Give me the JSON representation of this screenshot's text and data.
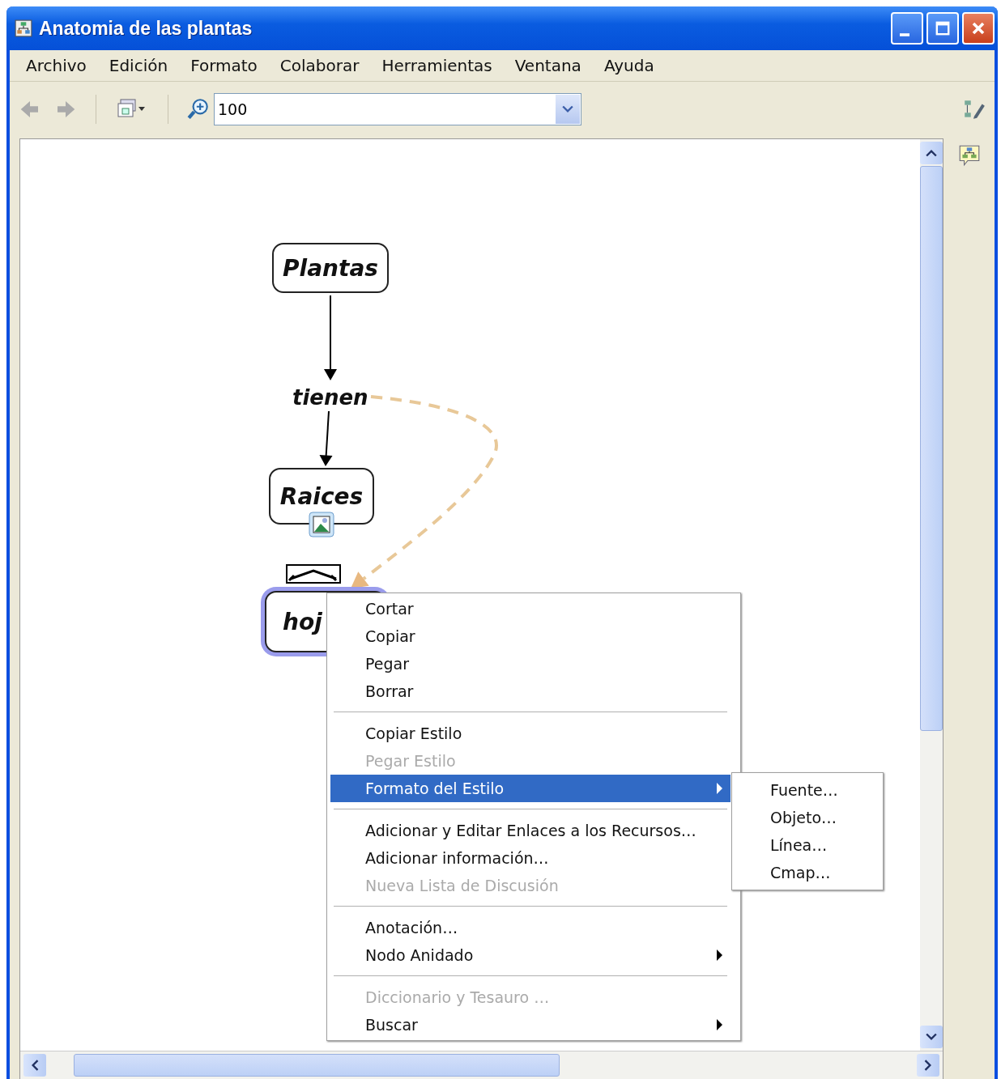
{
  "window": {
    "title": "Anatomia de las plantas"
  },
  "menu_bar": [
    "Archivo",
    "Edición",
    "Formato",
    "Colaborar",
    "Herramientas",
    "Ventana",
    "Ayuda"
  ],
  "toolbar": {
    "zoom_field": {
      "value": "100"
    }
  },
  "concept_map": {
    "concepts": [
      {
        "label": "Plantas",
        "selected": false,
        "has_image": false
      },
      {
        "label": "Raices",
        "selected": false,
        "has_image": true
      },
      {
        "label": "hoj",
        "selected": true,
        "has_image": false
      }
    ],
    "linking_phrases": [
      {
        "label": "tienen"
      }
    ]
  },
  "context_menu": {
    "items": [
      {
        "kind": "item",
        "label": "Cortar",
        "disabled": false,
        "selected": false,
        "has_submenu": false
      },
      {
        "kind": "item",
        "label": "Copiar",
        "disabled": false,
        "selected": false,
        "has_submenu": false
      },
      {
        "kind": "item",
        "label": "Pegar",
        "disabled": false,
        "selected": false,
        "has_submenu": false
      },
      {
        "kind": "item",
        "label": "Borrar",
        "disabled": false,
        "selected": false,
        "has_submenu": false
      },
      {
        "kind": "separator"
      },
      {
        "kind": "item",
        "label": "Copiar Estilo",
        "disabled": false,
        "selected": false,
        "has_submenu": false
      },
      {
        "kind": "item",
        "label": "Pegar Estilo",
        "disabled": true,
        "selected": false,
        "has_submenu": false
      },
      {
        "kind": "item",
        "label": "Formato del Estilo",
        "disabled": false,
        "selected": true,
        "has_submenu": true
      },
      {
        "kind": "separator"
      },
      {
        "kind": "item",
        "label": "Adicionar y Editar Enlaces a los Recursos…",
        "disabled": false,
        "selected": false,
        "has_submenu": false
      },
      {
        "kind": "item",
        "label": "Adicionar información…",
        "disabled": false,
        "selected": false,
        "has_submenu": false
      },
      {
        "kind": "item",
        "label": "Nueva Lista de Discusión",
        "disabled": true,
        "selected": false,
        "has_submenu": false
      },
      {
        "kind": "separator"
      },
      {
        "kind": "item",
        "label": "Anotación…",
        "disabled": false,
        "selected": false,
        "has_submenu": false
      },
      {
        "kind": "item",
        "label": "Nodo Anidado",
        "disabled": false,
        "selected": false,
        "has_submenu": true
      },
      {
        "kind": "separator"
      },
      {
        "kind": "item",
        "label": "Diccionario y Tesauro …",
        "disabled": true,
        "selected": false,
        "has_submenu": false
      },
      {
        "kind": "item",
        "label": "Buscar",
        "disabled": false,
        "selected": false,
        "has_submenu": true
      }
    ]
  },
  "submenu": {
    "items": [
      {
        "label": "Fuente…",
        "selected": false
      },
      {
        "label": "Objeto…",
        "selected": false
      },
      {
        "label": "Línea…",
        "selected": false
      },
      {
        "label": "Cmap…",
        "selected": false
      }
    ]
  }
}
